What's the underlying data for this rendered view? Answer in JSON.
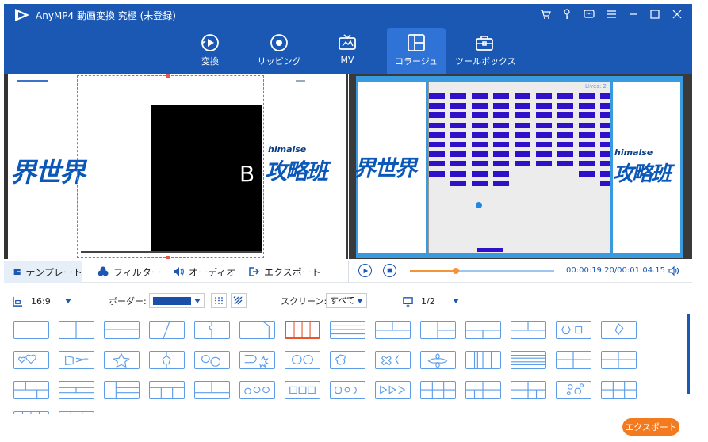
{
  "app": {
    "title": "AnyMP4 動画変換 究極 (未登録)"
  },
  "nav": {
    "tabs": [
      {
        "key": "convert",
        "label": "変換"
      },
      {
        "key": "ripping",
        "label": "リッピング"
      },
      {
        "key": "mv",
        "label": "MV"
      },
      {
        "key": "collage",
        "label": "コラージュ",
        "active": true
      },
      {
        "key": "toolbox",
        "label": "ツールボックス"
      }
    ]
  },
  "preview": {
    "left_text": "界世界",
    "left_text2": "攻略班",
    "left_small": "himalse",
    "left_letters": "B",
    "right_text": "界世界",
    "right_text2": "攻略班",
    "right_small": "himalse",
    "game_lives": "Lives: 2"
  },
  "subtabs": {
    "template": "テンプレート",
    "filter": "フィルター",
    "audio": "オーディオ",
    "export": "エクスポート"
  },
  "player": {
    "time": "00:00:19.20/00:01:04.15",
    "progress": 0.32
  },
  "options": {
    "aspect": "16:9",
    "border_label": "ボーダー:",
    "border_color": "#1a4fa8",
    "screen_label": "スクリーン:",
    "screen_value": "すべて",
    "page": "1/2"
  },
  "colors": {
    "brand": "#1a58b4",
    "accent": "#f37a1f",
    "template_border": "#5c9ce8",
    "template_selected": "#e5572f"
  },
  "export_button": "エクスポート"
}
